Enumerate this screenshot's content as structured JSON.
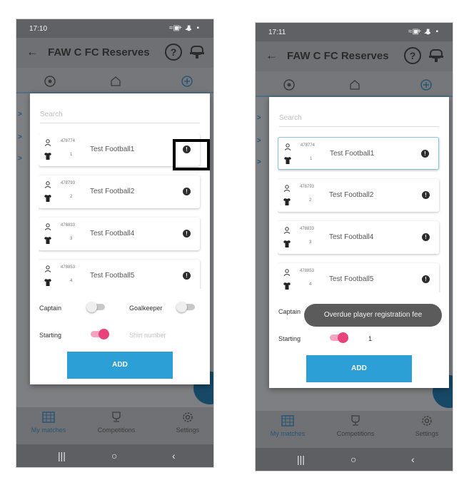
{
  "phones": [
    {
      "status_time": "17:10",
      "toast": "",
      "shirt_number_value": "",
      "selected_row": -1
    },
    {
      "status_time": "17:11",
      "toast": "Overdue player registration fee",
      "shirt_number_value": "1",
      "selected_row": 0
    }
  ],
  "app": {
    "title": "FAW C FC Reserves",
    "back_icon": "arrow-left-icon",
    "help_icon": "help-circle-icon",
    "whistle_icon": "whistle-icon",
    "help_glyph": "?"
  },
  "tabs": [
    {
      "icon": "soccer-ball-icon"
    },
    {
      "icon": "stadium-icon"
    },
    {
      "icon": "add-circle-icon",
      "active": true
    }
  ],
  "dialog": {
    "search_placeholder": "Search",
    "players": [
      {
        "id": "478774",
        "number": "1",
        "name": "Test Football1"
      },
      {
        "id": "478793",
        "number": "2",
        "name": "Test Football2"
      },
      {
        "id": "478833",
        "number": "3",
        "name": "Test Football4"
      },
      {
        "id": "478853",
        "number": "4",
        "name": "Test Football5"
      }
    ],
    "captain_label": "Captain",
    "goalkeeper_label": "Goalkeeper",
    "starting_label": "Starting",
    "shirt_number_placeholder": "Shirt number",
    "add_label": "ADD",
    "captain_on": false,
    "goalkeeper_on": false,
    "starting_on": true
  },
  "bottom_nav": [
    {
      "label": "My matches",
      "icon": "calendar-grid-icon",
      "active": true
    },
    {
      "label": "Competitions",
      "icon": "trophy-icon"
    },
    {
      "label": "Settings",
      "icon": "gear-icon"
    }
  ],
  "system_nav": {
    "recents": "|||",
    "home": "○",
    "back": "‹"
  },
  "colors": {
    "accent_blue": "#2b9fd6",
    "toggle_on": "#e8437a",
    "nav_active": "#2a5575",
    "fab": "#174967"
  }
}
